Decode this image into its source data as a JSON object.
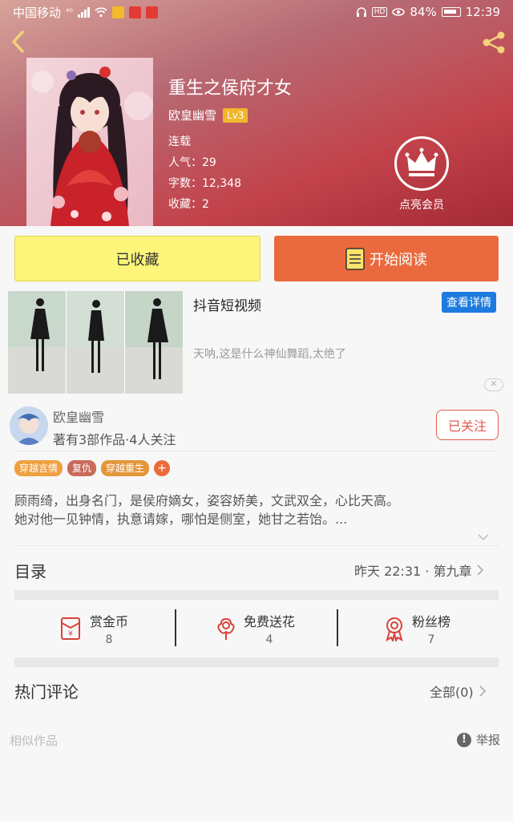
{
  "status_bar": {
    "carrier": "中国移动",
    "network": "⁴ᴳ",
    "battery": "84%",
    "time": "12:39"
  },
  "book": {
    "title": "重生之侯府才女",
    "author": "欧皇幽雪",
    "author_level": "Lv3",
    "status": "连载",
    "popularity": "人气：29",
    "word_count": "字数：12,348",
    "favorites": "收藏：2",
    "vip_label": "点亮会员"
  },
  "actions": {
    "favorited_label": "已收藏",
    "read_label": "开始阅读"
  },
  "ad": {
    "title": "抖音短视频",
    "detail_label": "查看详情",
    "description": "天呐,这是什么神仙舞蹈,太绝了",
    "close_label": "✕"
  },
  "author_card": {
    "name": "欧皇幽雪",
    "stats": "著有3部作品·4人关注",
    "follow_label": "已关注"
  },
  "tags": [
    {
      "label": "穿越言情",
      "color": "#f0a040"
    },
    {
      "label": "复仇",
      "color": "#c96a5a"
    },
    {
      "label": "穿越重生",
      "color": "#e4963b"
    }
  ],
  "tag_add": "+",
  "synopsis": {
    "line1": "顾雨绮，出身名门，是侯府嫡女，姿容娇美，文武双全，心比天高。",
    "line2": "她对他一见钟情，执意请嫁，哪怕是侧室，她甘之若饴。..."
  },
  "toc": {
    "label": "目录",
    "latest": "昨天 22:31 · 第九章"
  },
  "stats": [
    {
      "label": "赏金币",
      "count": "8",
      "icon": "red-envelope-icon"
    },
    {
      "label": "免费送花",
      "count": "4",
      "icon": "flower-icon"
    },
    {
      "label": "粉丝榜",
      "count": "7",
      "icon": "medal-icon"
    }
  ],
  "comments": {
    "label": "热门评论",
    "all": "全部(0)"
  },
  "footer": {
    "similar": "相似作品",
    "report": "举报",
    "report_icon_glyph": "!"
  },
  "colors": {
    "accent_orange": "#ea6a3e",
    "fav_yellow": "#fdf579",
    "follow_red": "#e35b4c",
    "ad_blue": "#1d7be0"
  }
}
